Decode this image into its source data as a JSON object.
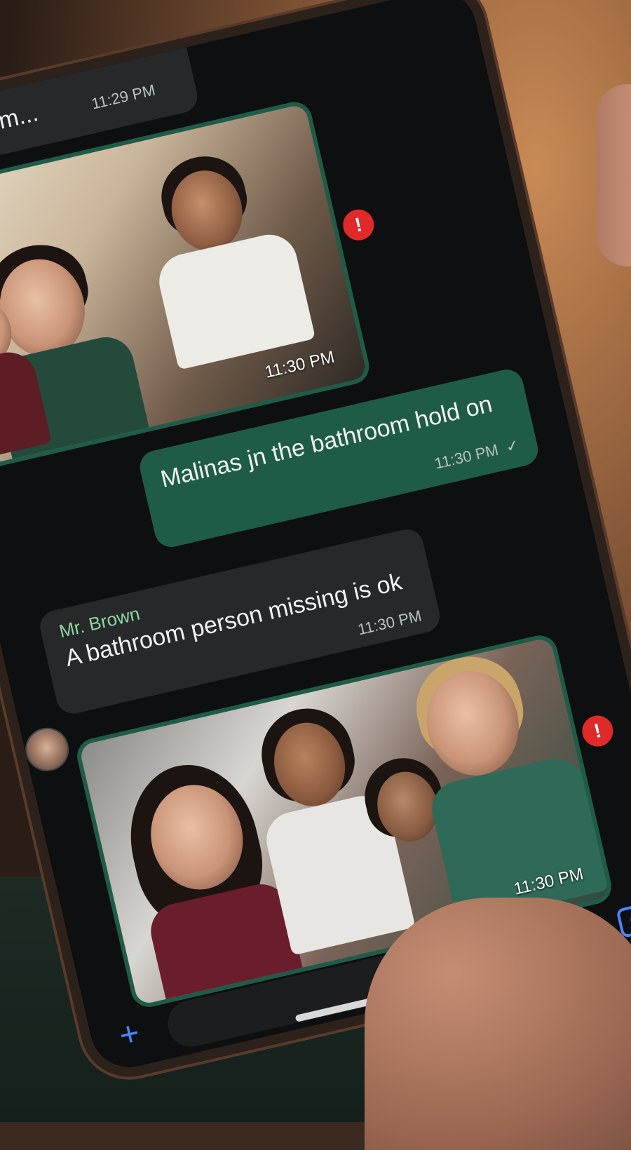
{
  "conversation": {
    "partial_message": {
      "text": "last room...",
      "time": "11:29 PM"
    },
    "photo_1": {
      "time": "11:30 PM",
      "status": "!"
    },
    "outgoing_message": {
      "text": "Malinas jn the bathroom hold on",
      "time": "11:30 PM",
      "check": "✓"
    },
    "incoming_message": {
      "sender": "Mr. Brown",
      "text": "A bathroom person missing is ok",
      "time": "11:30 PM"
    },
    "photo_2": {
      "time": "11:30 PM",
      "status": "!"
    }
  },
  "composer": {
    "add_icon": "+",
    "sticker_icon": "sticker-icon",
    "camera_icon": "camera-icon"
  },
  "colors": {
    "outgoing_bubble": "#1f5c48",
    "incoming_bubble": "#262829",
    "sender_name": "#8fd6a3",
    "accent": "#4a86ff",
    "alert": "#e02a2a"
  }
}
